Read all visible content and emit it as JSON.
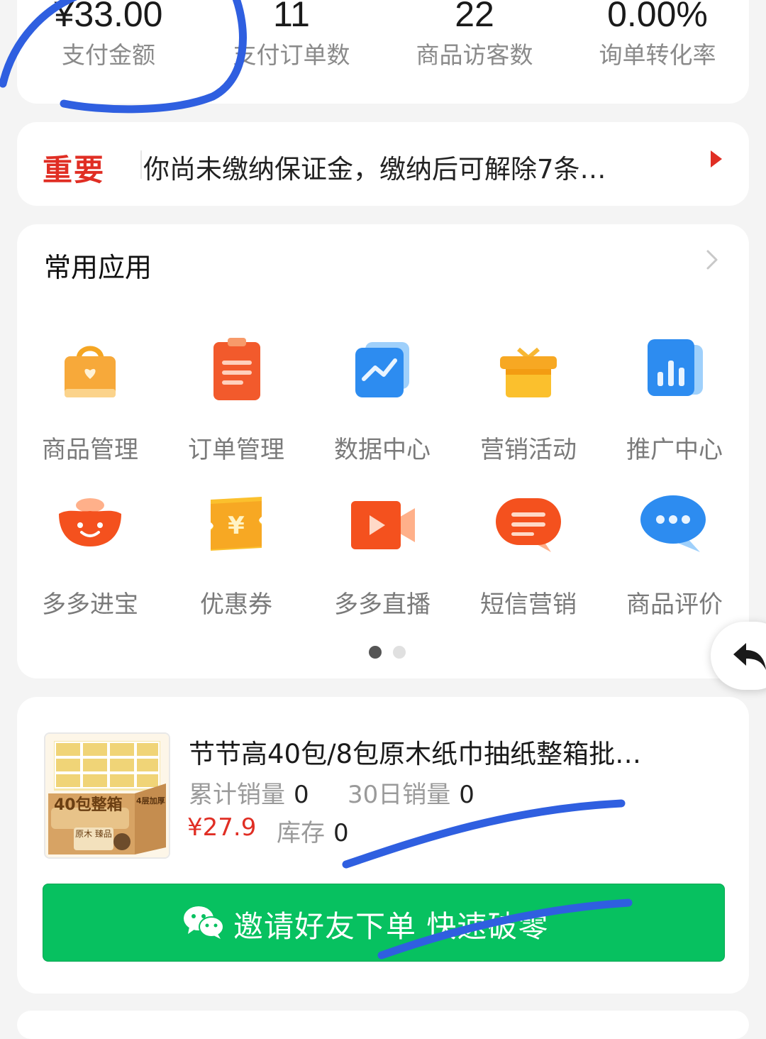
{
  "stats": [
    {
      "value": "¥33.00",
      "label": "支付金额"
    },
    {
      "value": "11",
      "label": "支付订单数"
    },
    {
      "value": "22",
      "label": "商品访客数"
    },
    {
      "value": "0.00%",
      "label": "询单转化率"
    }
  ],
  "notice": {
    "tag": "重要",
    "message": "你尚未缴纳保证金，缴纳后可解除7条…"
  },
  "apps": {
    "title": "常用应用",
    "items": [
      {
        "label": "商品管理",
        "icon": "shopping-bag-icon"
      },
      {
        "label": "订单管理",
        "icon": "clipboard-icon"
      },
      {
        "label": "数据中心",
        "icon": "line-chart-icon"
      },
      {
        "label": "营销活动",
        "icon": "gift-icon"
      },
      {
        "label": "推广中心",
        "icon": "bar-chart-icon"
      },
      {
        "label": "多多进宝",
        "icon": "gold-ingot-icon"
      },
      {
        "label": "优惠券",
        "icon": "coupon-icon"
      },
      {
        "label": "多多直播",
        "icon": "video-camera-icon"
      },
      {
        "label": "短信营销",
        "icon": "sms-bubble-icon"
      },
      {
        "label": "商品评价",
        "icon": "comment-bubble-icon"
      }
    ],
    "page_count": 2,
    "active_page": 1
  },
  "product": {
    "name": "节节高40包/8包原木纸巾抽纸整箱批…",
    "total_sales_label": "累计销量",
    "total_sales": "0",
    "sales_30d_label": "30日销量",
    "sales_30d": "0",
    "price": "¥27.9",
    "stock_label": "库存",
    "stock": "0",
    "thumb_text_main": "40包整箱",
    "thumb_text_side": "4层加厚",
    "thumb_brand": "原木 臻品",
    "invite_button": "邀请好友下单 快速破零"
  },
  "colors": {
    "accent_red": "#e02e24",
    "wechat_green": "#07c160",
    "annotation_blue": "#2f5fe0"
  }
}
